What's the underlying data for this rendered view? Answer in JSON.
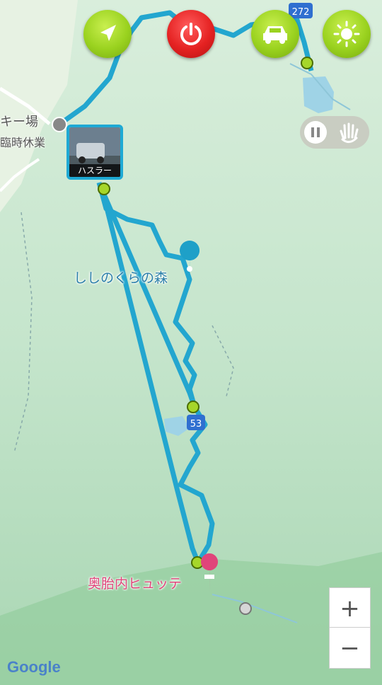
{
  "map": {
    "labels": {
      "ski_partial": "キー場",
      "ski_closed": "臨時休業",
      "forest": "ししのくらの森",
      "hut": "奥胎内ヒュッテ",
      "route_53": "53",
      "route_272": "272"
    },
    "attribution": "Google"
  },
  "vehicle": {
    "label": "ハスラー"
  },
  "toolbar": {
    "navigate_icon": "navigation-arrow-icon",
    "power_icon": "power-icon",
    "car_icon": "car-icon",
    "brightness_icon": "sun-icon"
  },
  "controls": {
    "zoom_in": "+",
    "zoom_out": "−"
  },
  "colors": {
    "route": "#23a6cf",
    "button_green": "#9ad21f",
    "button_red": "#e52222",
    "checkpoint": "#a6d62a",
    "poi_pink": "#e0457a"
  }
}
